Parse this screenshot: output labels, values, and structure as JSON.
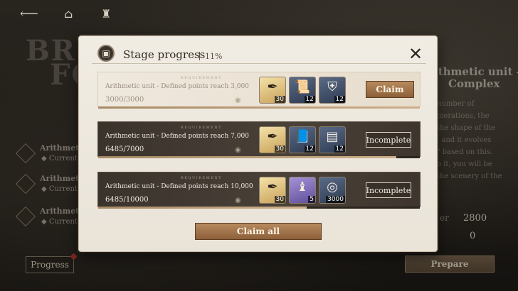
{
  "topbar": {
    "back_icon": "back-arrow-icon",
    "home_icon": "home-icon",
    "character_icon": "character-icon"
  },
  "background": {
    "title_line1": "BRUT",
    "title_line2": "FO",
    "side_items": [
      {
        "label": "Arithmetic u",
        "sub": "Current p"
      },
      {
        "label": "Arithmetic u",
        "sub": "Current p"
      },
      {
        "label": "Arithmetic u",
        "sub": "Current p"
      }
    ],
    "progress_button": "Progress",
    "right_title_line1": "ithmetic unit -",
    "right_title_line2": "Complex",
    "right_text": [
      "number of",
      "merations, the",
      "the shape of the",
      ", and it evolves",
      "\" based on this.",
      "o it, you will be",
      "the scenery of the"
    ],
    "stat_label": "er",
    "stat_values": [
      "2800",
      "0"
    ],
    "prepare_button": "Prepare"
  },
  "modal": {
    "title": "Stage progress",
    "percent": "11%",
    "requirement_label": "REQUIREMENT",
    "rows": [
      {
        "title": "Arithmetic unit - Defined points reach 3,000",
        "count": "3000/3000",
        "progress": 1.0,
        "action": "Claim",
        "rewards": [
          {
            "icon": "quill-pen-icon",
            "qty": "30"
          },
          {
            "icon": "scroll-icon",
            "qty": "12"
          },
          {
            "icon": "shield-plate-icon",
            "qty": "12"
          }
        ]
      },
      {
        "title": "Arithmetic unit - Defined points reach 7,000",
        "count": "6485/7000",
        "progress": 0.926,
        "action": "Incomplete",
        "rewards": [
          {
            "icon": "quill-pen-icon",
            "qty": "30"
          },
          {
            "icon": "book-icon",
            "qty": "12"
          },
          {
            "icon": "painting-icon",
            "qty": "12"
          }
        ]
      },
      {
        "title": "Arithmetic unit - Defined points reach 10,000",
        "count": "6485/10000",
        "progress": 0.6485,
        "action": "Incomplete",
        "rewards": [
          {
            "icon": "quill-pen-icon",
            "qty": "30"
          },
          {
            "icon": "pouch-icon",
            "qty": "5"
          },
          {
            "icon": "coin-icon",
            "qty": "3000"
          }
        ]
      }
    ],
    "claim_all": "Claim all"
  }
}
